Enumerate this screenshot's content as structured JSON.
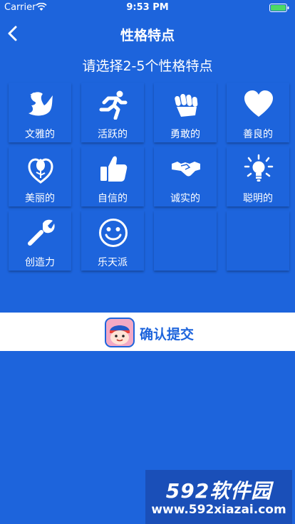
{
  "status_bar": {
    "carrier": "Carrier",
    "time": "9:53 PM",
    "battery_color": "#4cd964"
  },
  "nav": {
    "back_icon": "chevron-left-icon",
    "title": "性格特点"
  },
  "subtitle": "请选择2-5个性格特点",
  "traits": [
    {
      "label": "文雅的",
      "icon": "swan-icon"
    },
    {
      "label": "活跃的",
      "icon": "runner-icon"
    },
    {
      "label": "勇敢的",
      "icon": "fist-icon"
    },
    {
      "label": "善良的",
      "icon": "heart-icon"
    },
    {
      "label": "美丽的",
      "icon": "rose-heart-icon"
    },
    {
      "label": "自信的",
      "icon": "thumbs-up-icon"
    },
    {
      "label": "诚实的",
      "icon": "handshake-icon"
    },
    {
      "label": "聪明的",
      "icon": "lightbulb-icon"
    },
    {
      "label": "创造力",
      "icon": "wrench-icon"
    },
    {
      "label": "乐天派",
      "icon": "smiley-icon"
    }
  ],
  "confirm": {
    "label": "确认提交",
    "icon": "app-avatar-icon"
  },
  "watermark": {
    "brand": "592软件园",
    "url": "www.592xiazai.com"
  },
  "colors": {
    "background": "#1d64dc",
    "accent": "#1d64dc",
    "white": "#ffffff"
  }
}
